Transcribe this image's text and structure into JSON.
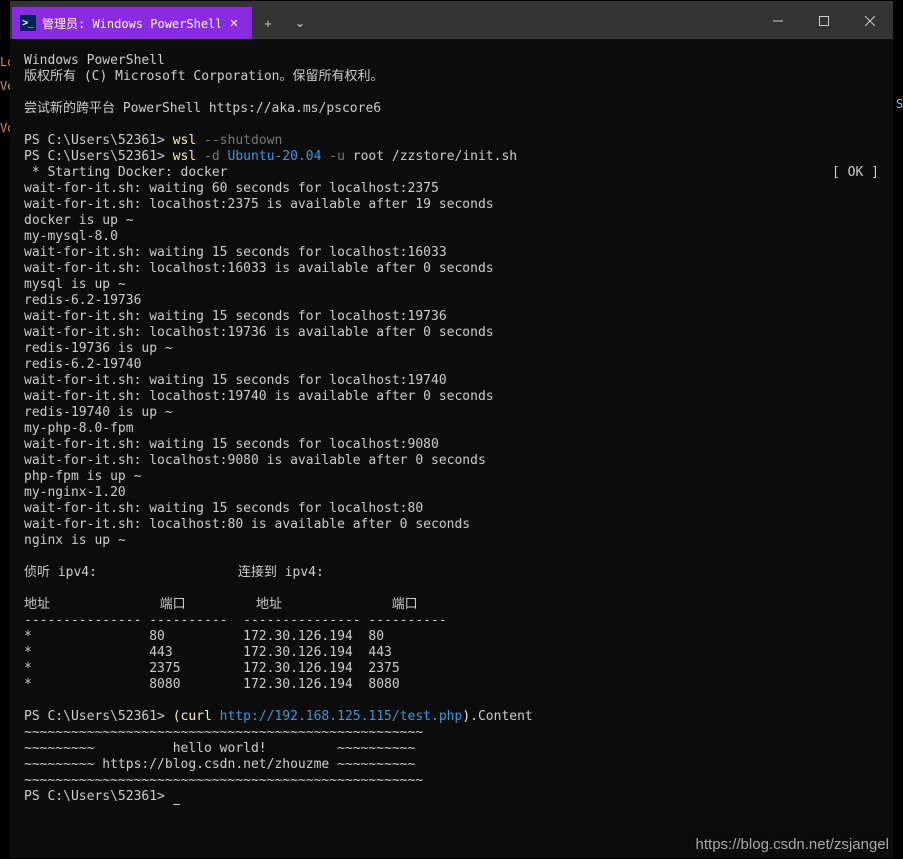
{
  "tab": {
    "title": "管理员: Windows PowerShell",
    "icon": ">_"
  },
  "controls": {
    "new_tab": "+",
    "dropdown": "⌄",
    "close": "✕"
  },
  "terminal": {
    "banner1": "Windows PowerShell",
    "banner2": "版权所有 (C) Microsoft Corporation。保留所有权利。",
    "banner3": "尝试新的跨平台 PowerShell https://aka.ms/pscore6",
    "prompt": "PS C:\\Users\\52361> ",
    "cmd1": {
      "wsl": "wsl",
      "arg": " --shutdown"
    },
    "cmd2": {
      "wsl": "wsl",
      "d": " -d",
      "dist": " Ubuntu-20.04",
      "u": " -u",
      "rest": " root /zzstore/init.sh"
    },
    "docker_start": " * Starting Docker: docker",
    "ok": "[ OK ]",
    "lines": [
      "wait-for-it.sh: waiting 60 seconds for localhost:2375",
      "wait-for-it.sh: localhost:2375 is available after 19 seconds",
      "docker is up ~",
      "my-mysql-8.0",
      "wait-for-it.sh: waiting 15 seconds for localhost:16033",
      "wait-for-it.sh: localhost:16033 is available after 0 seconds",
      "mysql is up ~",
      "redis-6.2-19736",
      "wait-for-it.sh: waiting 15 seconds for localhost:19736",
      "wait-for-it.sh: localhost:19736 is available after 0 seconds",
      "redis-19736 is up ~",
      "redis-6.2-19740",
      "wait-for-it.sh: waiting 15 seconds for localhost:19740",
      "wait-for-it.sh: localhost:19740 is available after 0 seconds",
      "redis-19740 is up ~",
      "my-php-8.0-fpm",
      "wait-for-it.sh: waiting 15 seconds for localhost:9080",
      "wait-for-it.sh: localhost:9080 is available after 0 seconds",
      "php-fpm is up ~",
      "my-nginx-1.20",
      "wait-for-it.sh: waiting 15 seconds for localhost:80",
      "wait-for-it.sh: localhost:80 is available after 0 seconds",
      "nginx is up ~"
    ],
    "netstat": {
      "header": "侦听 ipv4:                  连接到 ipv4:",
      "cols": "地址              端口         地址              端口",
      "sep": "--------------- ----------  --------------- ----------",
      "rows": [
        "*               80          172.30.126.194  80",
        "*               443         172.30.126.194  443",
        "*               2375        172.30.126.194  2375",
        "*               8080        172.30.126.194  8080"
      ]
    },
    "cmd3": {
      "open": "(",
      "curl": "curl",
      "url": " http://192.168.125.115/test.php",
      ")": ")",
      "prop": ".Content"
    },
    "output2": [
      "~~~~~~~~~~~~~~~~~~~~~~~~~~~~~~~~~~~~~~~~~~~~~~~~~~~",
      "~~~~~~~~~          hello world!         ~~~~~~~~~~",
      "~~~~~~~~~ https://blog.csdn.net/zhouzme ~~~~~~~~~~",
      "~~~~~~~~~~~~~~~~~~~~~~~~~~~~~~~~~~~~~~~~~~~~~~~~~~~"
    ]
  },
  "behind": {
    "t1": "Lo",
    "t2": "Ve",
    "t3": "Vo"
  },
  "watermark": "https://blog.csdn.net/zsjangel"
}
